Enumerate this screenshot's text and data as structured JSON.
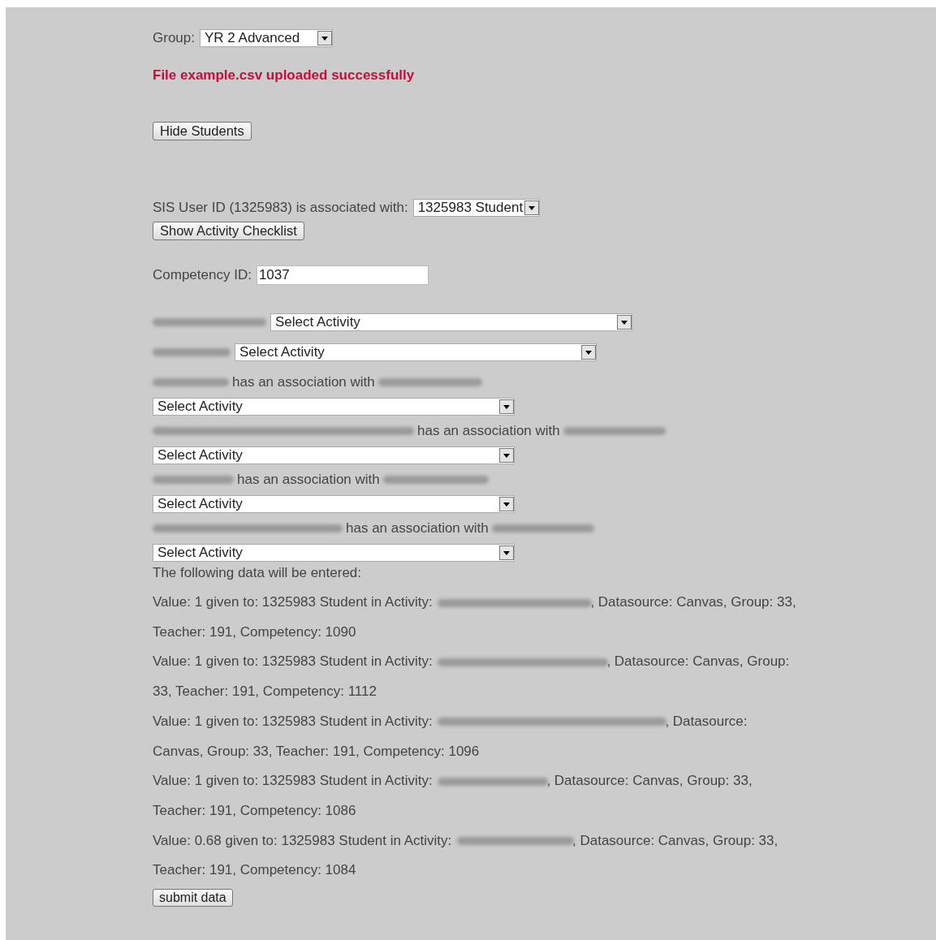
{
  "group": {
    "label": "Group:",
    "value": "YR 2 Advanced"
  },
  "message": "File example.csv uploaded successfully",
  "hide_button": "Hide Students",
  "sis": {
    "label": "SIS User ID (1325983) is associated with:",
    "value": "1325983 Student"
  },
  "checklist_button": "Show Activity Checklist",
  "competency": {
    "label": "Competency ID:",
    "value": "1037"
  },
  "activity_selects": [
    {
      "kind": "labeled",
      "value": "Select Activity"
    },
    {
      "kind": "labeled",
      "value": "Select Activity"
    },
    {
      "kind": "association",
      "text": "has an association with",
      "value": "Select Activity"
    },
    {
      "kind": "association",
      "text": "has an association with",
      "value": "Select Activity"
    },
    {
      "kind": "association",
      "text": "has an association with",
      "value": "Select Activity"
    },
    {
      "kind": "association",
      "text": "has an association with",
      "value": "Select Activity"
    }
  ],
  "summary_heading": "The following data will be entered:",
  "entries": [
    {
      "before": "Value: 1 given to: 1325983 Student in Activity:",
      "after": ", Datasource: Canvas, Group: 33, Teacher: 191, Competency: 1090"
    },
    {
      "before": "Value: 1 given to: 1325983 Student in Activity:",
      "after": ", Datasource: Canvas, Group: 33, Teacher: 191, Competency: 1112"
    },
    {
      "before": "Value: 1 given to: 1325983 Student in Activity:",
      "after": ", Datasource: Canvas, Group: 33, Teacher: 191, Competency: 1096"
    },
    {
      "before": "Value: 1 given to: 1325983 Student in Activity:",
      "after": ", Datasource: Canvas, Group: 33, Teacher: 191, Competency: 1086"
    },
    {
      "before": "Value: 0.68 given to: 1325983 Student in Activity:",
      "after": ", Datasource: Canvas, Group: 33, Teacher: 191, Competency: 1084"
    }
  ],
  "submit_button": "submit data"
}
